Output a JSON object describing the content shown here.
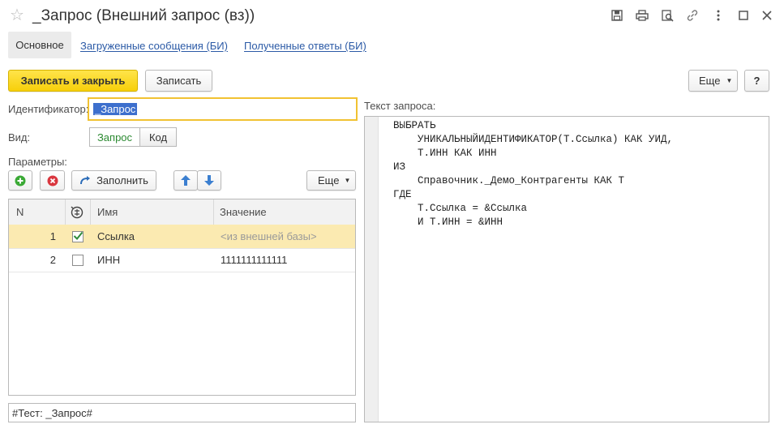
{
  "window": {
    "title": "_Запрос (Внешний запрос  (вз))",
    "star_icon": "star-icon",
    "title_icons": [
      "save-icon",
      "print-icon",
      "preview-icon",
      "link-icon",
      "more-vert-icon",
      "maximize-icon",
      "close-icon"
    ]
  },
  "tabs": {
    "main": "Основное",
    "loaded": "Загруженные сообщения (БИ)",
    "received": "Полученные ответы (БИ)"
  },
  "toolbar": {
    "save_close": "Записать и закрыть",
    "save": "Записать",
    "more": "Еще",
    "help": "?"
  },
  "form": {
    "id_label": "Идентификатор:",
    "id_value": "_Запрос",
    "kind_label": "Вид:",
    "kind_options": [
      "Запрос",
      "Код"
    ],
    "kind_selected": "Запрос",
    "params_label": "Параметры:",
    "fill_label": "Заполнить",
    "more_label": "Еще"
  },
  "params_table": {
    "headers": {
      "n": "N",
      "name": "Имя",
      "value": "Значение"
    },
    "rows": [
      {
        "n": "1",
        "checked": true,
        "name": "Ссылка",
        "value": "<из внешней базы>"
      },
      {
        "n": "2",
        "checked": false,
        "name": "ИНН",
        "value": "1111111111111"
      }
    ]
  },
  "test_field": "#Тест: _Запрос#",
  "query": {
    "label": "Текст запроса:",
    "lines": [
      "ВЫБРАТЬ",
      "    УНИКАЛЬНЫЙИДЕНТИФИКАТОР(Т.Ссылка) КАК УИД,",
      "    Т.ИНН КАК ИНН",
      "ИЗ",
      "    Справочник._Демо_Контрагенты КАК Т",
      "ГДЕ",
      "    Т.Ссылка = &Ссылка",
      "    И Т.ИНН = &ИНН"
    ]
  },
  "colors": {
    "accent_yellow": "#f7cf0a",
    "link_blue": "#2b5aa6",
    "selected_row": "#fbeab1",
    "focus_border": "#f1c232",
    "green": "#3aa935",
    "red": "#d9363e"
  }
}
